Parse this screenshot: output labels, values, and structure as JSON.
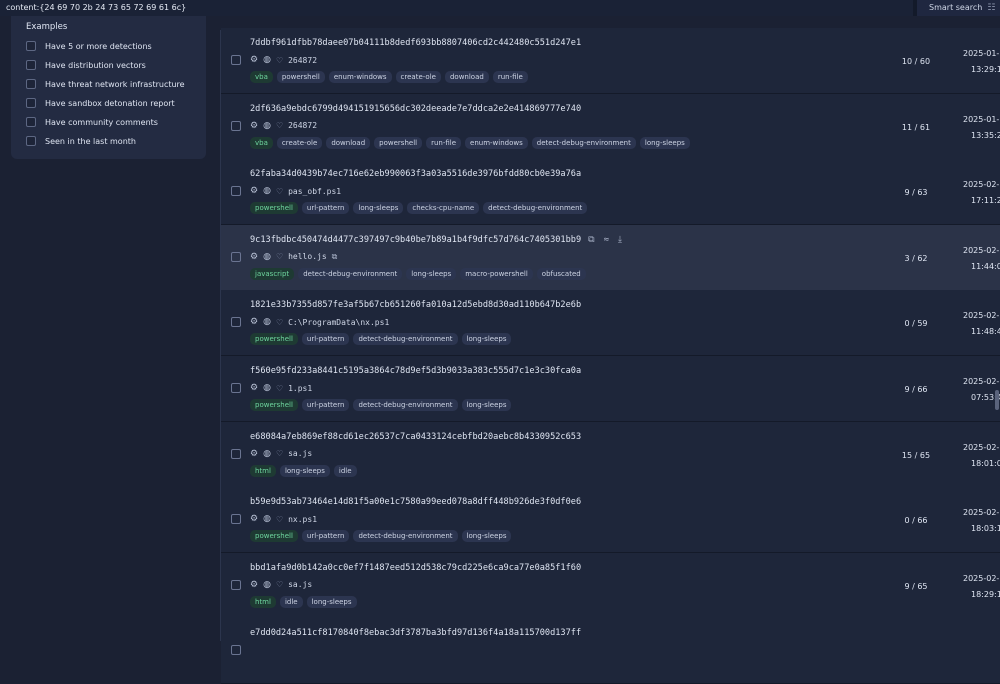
{
  "search": {
    "query": "content:{24 69 70 2b 24 73 65 72 69 61 6c}",
    "smart_search_label": "Smart search"
  },
  "examples": {
    "title": "Examples",
    "items": [
      "Have 5 or more detections",
      "Have distribution vectors",
      "Have threat network infrastructure",
      "Have sandbox detonation report",
      "Have community comments",
      "Seen in the last month"
    ]
  },
  "rows": [
    {
      "hash": "7ddbf961dfbb78daee07b04111b8dedf693bb8807406cd2c442480c551d247e1",
      "name": "264872",
      "tags": [
        [
          "vba",
          1
        ],
        [
          "powershell",
          0
        ],
        [
          "enum-windows",
          0
        ],
        [
          "create-ole",
          0
        ],
        [
          "download",
          0
        ],
        [
          "run-file",
          0
        ]
      ],
      "detections": "10 / 60",
      "date": "2025-01-",
      "time": "13:29:1"
    },
    {
      "hash": "2df636a9ebdc6799d494151915656dc302deeade7e7ddca2e2e414869777e740",
      "name": "264872",
      "tags": [
        [
          "vba",
          1
        ],
        [
          "create-ole",
          0
        ],
        [
          "download",
          0
        ],
        [
          "powershell",
          0
        ],
        [
          "run-file",
          0
        ],
        [
          "enum-windows",
          0
        ],
        [
          "detect-debug-environment",
          0
        ],
        [
          "long-sleeps",
          0
        ]
      ],
      "detections": "11 / 61",
      "date": "2025-01-",
      "time": "13:35:2"
    },
    {
      "hash": "62faba34d0439b74ec716e62eb990063f3a03a5516de3976bfdd80cb0e39a76a",
      "name": "pas_obf.ps1",
      "tags": [
        [
          "powershell",
          1
        ],
        [
          "url-pattern",
          0
        ],
        [
          "long-sleeps",
          0
        ],
        [
          "checks-cpu-name",
          0
        ],
        [
          "detect-debug-environment",
          0
        ]
      ],
      "detections": "9 / 63",
      "date": "2025-02-",
      "time": "17:11:2"
    },
    {
      "hash": "9c13fbdbc450474d4477c397497c9b40be7b89a1b4f9dfc57d764c7405301bb9",
      "name": "hello.js",
      "tags": [
        [
          "javascript",
          1
        ],
        [
          "detect-debug-environment",
          0
        ],
        [
          "long-sleeps",
          0
        ],
        [
          "macro-powershell",
          0
        ],
        [
          "obfuscated",
          0
        ]
      ],
      "detections": "3 / 62",
      "date": "2025-02-",
      "time": "11:44:0"
    },
    {
      "hash": "1821e33b7355d857fe3af5b67cb651260fa010a12d5ebd8d30ad110b647b2e6b",
      "name": "C:\\ProgramData\\nx.ps1",
      "tags": [
        [
          "powershell",
          1
        ],
        [
          "url-pattern",
          0
        ],
        [
          "detect-debug-environment",
          0
        ],
        [
          "long-sleeps",
          0
        ]
      ],
      "detections": "0 / 59",
      "date": "2025-02-",
      "time": "11:48:4"
    },
    {
      "hash": "f560e95fd233a8441c5195a3864c78d9ef5d3b9033a383c555d7c1e3c30fca0a",
      "name": "1.ps1",
      "tags": [
        [
          "powershell",
          1
        ],
        [
          "url-pattern",
          0
        ],
        [
          "detect-debug-environment",
          0
        ],
        [
          "long-sleeps",
          0
        ]
      ],
      "detections": "9 / 66",
      "date": "2025-02-",
      "time": "07:53:4"
    },
    {
      "hash": "e68084a7eb869ef88cd61ec26537c7ca0433124cebfbd20aebc8b4330952c653",
      "name": "sa.js",
      "tags": [
        [
          "html",
          1
        ],
        [
          "long-sleeps",
          0
        ],
        [
          "idle",
          0
        ]
      ],
      "detections": "15 / 65",
      "date": "2025-02-",
      "time": "18:01:0"
    },
    {
      "hash": "b59e9d53ab73464e14d81f5a00e1c7580a99eed078a8dff448b926de3f0df0e6",
      "name": "nx.ps1",
      "tags": [
        [
          "powershell",
          1
        ],
        [
          "url-pattern",
          0
        ],
        [
          "detect-debug-environment",
          0
        ],
        [
          "long-sleeps",
          0
        ]
      ],
      "detections": "0 / 66",
      "date": "2025-02-",
      "time": "18:03:1"
    },
    {
      "hash": "bbd1afa9d0b142a0cc0ef7f1487eed512d538c79cd225e6ca9ca77e0a85f1f60",
      "name": "sa.js",
      "tags": [
        [
          "html",
          1
        ],
        [
          "idle",
          0
        ],
        [
          "long-sleeps",
          0
        ]
      ],
      "detections": "9 / 65",
      "date": "2025-02-",
      "time": "18:29:1"
    },
    {
      "hash": "e7dd0d24a511cf8170840f8ebac3df3787ba3bfd97d136f4a18a115700d137ff",
      "name": "",
      "tags": [],
      "detections": "",
      "date": "",
      "time": ""
    }
  ],
  "highlighted_row": 3,
  "colors": {
    "accent_green": "#6fd79f",
    "background": "#1e263a",
    "highlight": "#2b3348"
  }
}
